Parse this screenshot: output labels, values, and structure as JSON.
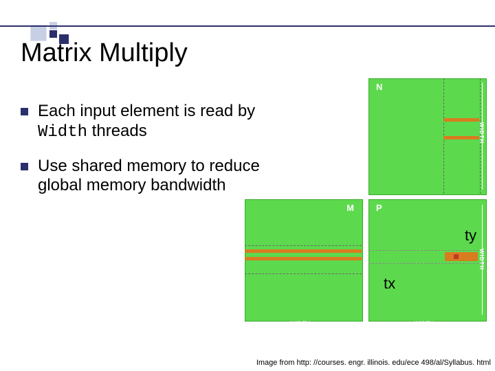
{
  "title": "Matrix Multiply",
  "bullet1": {
    "a": "Each input element is read by ",
    "code": "Width",
    "b": " threads"
  },
  "bullet2": "Use shared memory to reduce global memory bandwidth",
  "mat": {
    "N": "N",
    "M": "M",
    "P": "P"
  },
  "labels": {
    "ty": "ty",
    "tx": "tx"
  },
  "width_label": "WIDTH",
  "credit": "Image from http: //courses. engr. illinois. edu/ece 498/al/Syllabus. html"
}
